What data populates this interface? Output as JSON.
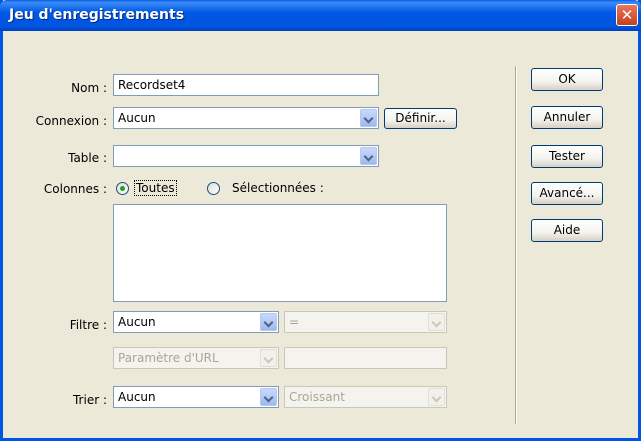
{
  "window": {
    "title": "Jeu d'enregistrements",
    "close_glyph": "✕"
  },
  "form": {
    "name_label": "Nom :",
    "name_value": "Recordset4",
    "connection_label": "Connexion :",
    "connection_value": "Aucun",
    "define_button": "Définir...",
    "table_label": "Table :",
    "table_value": "",
    "columns_label": "Colonnes :",
    "columns_all": "Toutes",
    "columns_selected": "Sélectionnées :",
    "columns_all_checked": true,
    "filter_label": "Filtre :",
    "filter_value": "Aucun",
    "filter_operator": "=",
    "filter_param": "Paramètre d'URL",
    "filter_param_value": "",
    "sort_label": "Trier :",
    "sort_value": "Aucun",
    "sort_order": "Croissant"
  },
  "buttons": {
    "ok": "OK",
    "cancel": "Annuler",
    "test": "Tester",
    "advanced": "Avancé...",
    "help": "Aide"
  }
}
